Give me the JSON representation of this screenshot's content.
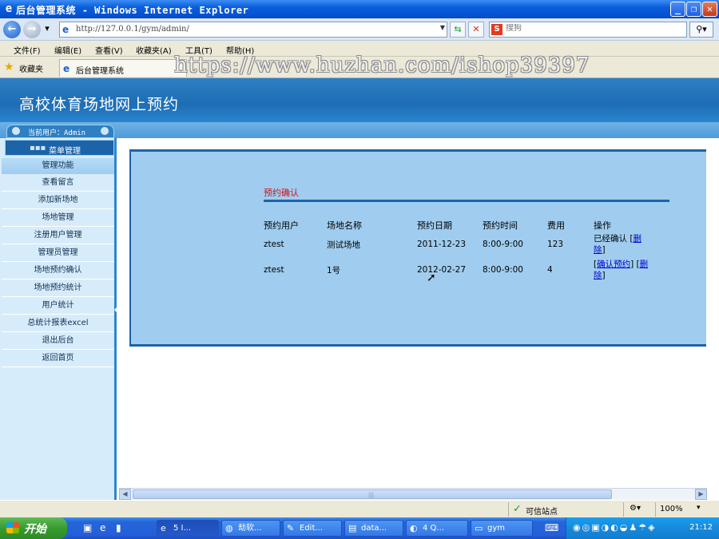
{
  "window": {
    "title": "后台管理系统 - Windows Internet Explorer",
    "minimize_glyph": "_",
    "maximize_glyph": "❐",
    "close_glyph": "✕"
  },
  "browser": {
    "url": "http://127.0.0.1/gym/admin/",
    "search_placeholder": "搜狗",
    "menus": [
      "文件(F)",
      "编辑(E)",
      "查看(V)",
      "收藏夹(A)",
      "工具(T)",
      "帮助(H)"
    ],
    "favorites_label": "收藏夹",
    "tab_label": "后台管理系统",
    "watermark": "https://www.huzhan.com/ishop39397"
  },
  "site": {
    "title": "高校体育场地网上预约",
    "current_user": "当前用户：Admin",
    "menu_header": "菜单管理",
    "section_header": "管理功能",
    "sidebar_items": [
      "查看留言",
      "添加新场地",
      "场地管理",
      "注册用户管理",
      "管理员管理",
      "场地预约确认",
      "场地预约统计",
      "用户统计",
      "总统计报表excel",
      "退出后台",
      "返回首页"
    ]
  },
  "reservations": {
    "title": "预约确认",
    "columns": [
      "预约用户",
      "场地名称",
      "预约日期",
      "预约时间",
      "费用",
      "操作"
    ],
    "rows": [
      {
        "user": "ztest",
        "venue": "测试场地",
        "date": "2011-12-23",
        "time": "8:00-9:00",
        "fee": "123",
        "status": "已经确认",
        "action2a": "删",
        "action2b": "除"
      },
      {
        "user": "ztest",
        "venue": "1号",
        "date": "2012-02-27",
        "time": "8:00-9:00",
        "fee": "4",
        "action1": "确认预约",
        "action2a": "删",
        "action2b": "除"
      }
    ]
  },
  "statusbar": {
    "trusted": "可信站点",
    "zoom": "100%"
  },
  "taskbar": {
    "start": "开始",
    "buttons": [
      "5 I...",
      "劫软...",
      "Edit...",
      "data...",
      "4 Q...",
      "gym"
    ],
    "clock": "21:12"
  },
  "colors": {
    "banner": "#1d6db5",
    "panel": "#a0cdef",
    "accent_red": "#d4101a",
    "link": "#0000cc"
  }
}
